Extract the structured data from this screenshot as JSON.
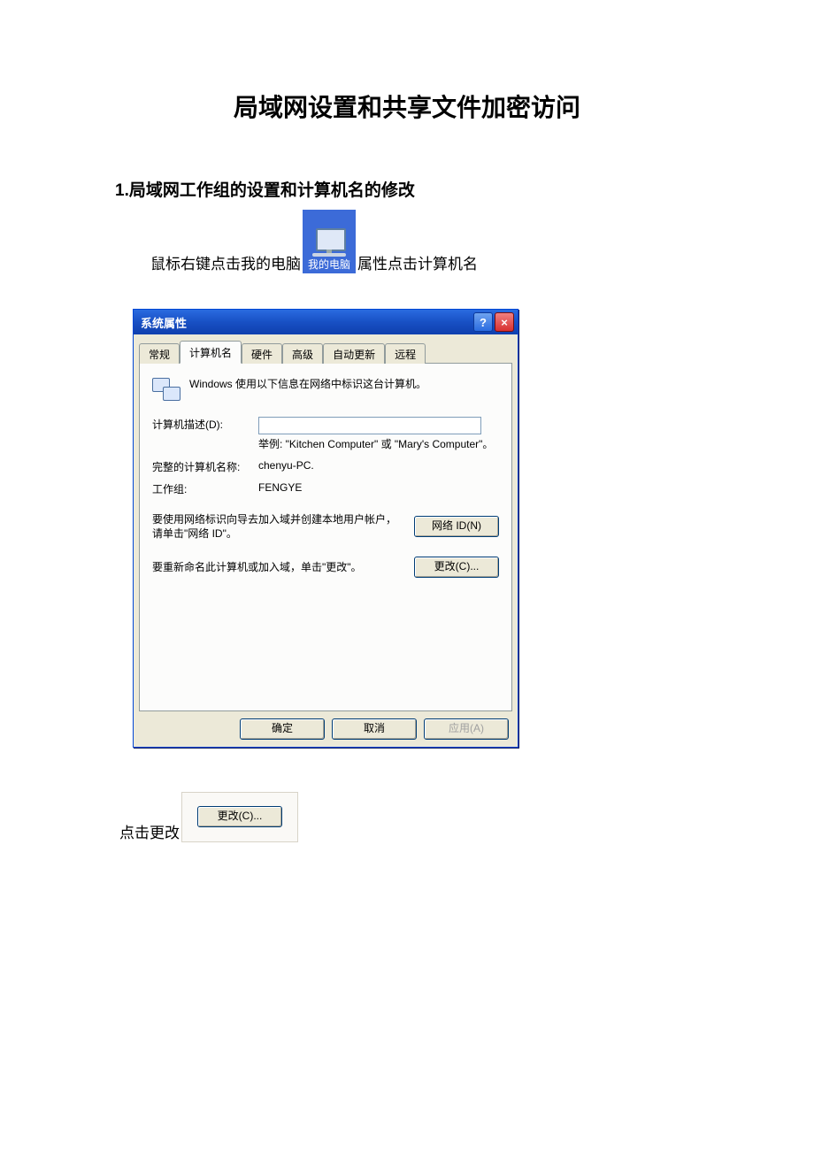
{
  "doc": {
    "title": "局域网设置和共享文件加密访问",
    "section1": "1.局域网工作组的设置和计算机名的修改",
    "line1_a": "鼠标右键点击我的电脑",
    "line1_b": "属性点击计算机名",
    "my_computer_icon_caption": "我的电脑",
    "click_change": "点击更改"
  },
  "dialog": {
    "title": "系统属性",
    "tabs": {
      "general": "常规",
      "computer_name": "计算机名",
      "hardware": "硬件",
      "advanced": "高级",
      "auto_update": "自动更新",
      "remote": "远程"
    },
    "info_text": "Windows 使用以下信息在网络中标识这台计算机。",
    "desc_label": "计算机描述(D):",
    "desc_value": "",
    "example_hint": "举例: \"Kitchen Computer\" 或 \"Mary's Computer\"。",
    "full_name_label": "完整的计算机名称:",
    "full_name_value": "chenyu-PC.",
    "workgroup_label": "工作组:",
    "workgroup_value": "FENGYE",
    "net_id_text": "要使用网络标识向导去加入域并创建本地用户帐户，请单击\"网络 ID\"。",
    "net_id_btn": "网络 ID(N)",
    "change_text": "要重新命名此计算机或加入域，单击\"更改\"。",
    "change_btn": "更改(C)...",
    "ok_btn": "确定",
    "cancel_btn": "取消",
    "apply_btn": "应用(A)"
  }
}
